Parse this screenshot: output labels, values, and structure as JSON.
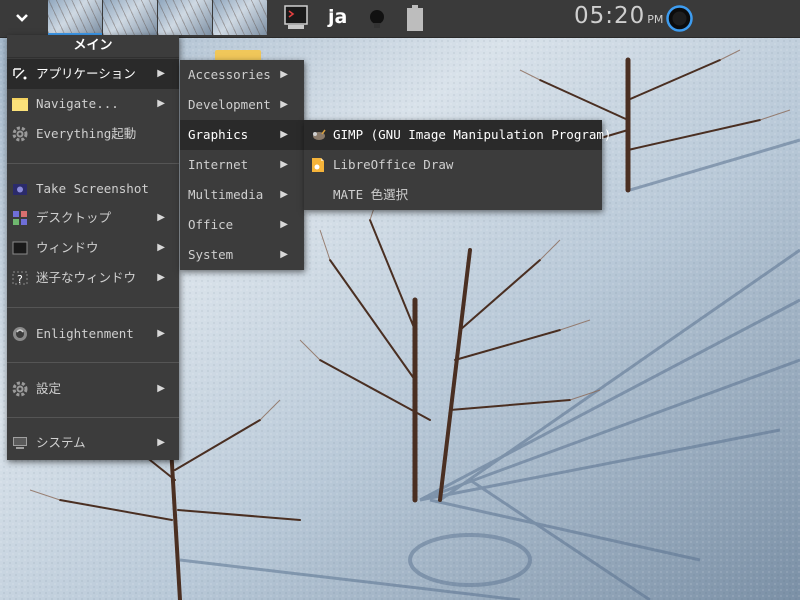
{
  "shelf": {
    "language": "ja",
    "clock_time": "05:20",
    "clock_ampm": "PM",
    "accent_color": "#3d9cf0",
    "icons": [
      "start-chevron-icon",
      "terminal-icon",
      "bulb-icon",
      "battery-icon",
      "power-icon"
    ]
  },
  "main_menu": {
    "title": "メイン",
    "items": [
      {
        "label": "アプリケーション",
        "icon": "applications-icon"
      },
      {
        "label": "Navigate...",
        "icon": "folder-icon"
      },
      {
        "label": "Everything起動",
        "icon": "gear-icon"
      },
      {
        "label": "Take Screenshot",
        "icon": "screenshot-icon"
      },
      {
        "label": "デスクトップ",
        "icon": "desktop-icon"
      },
      {
        "label": "ウィンドウ",
        "icon": "window-icon"
      },
      {
        "label": "迷子なウィンドウ",
        "icon": "lost-window-icon"
      },
      {
        "label": "Enlightenment",
        "icon": "enlightenment-icon"
      },
      {
        "label": "設定",
        "icon": "settings-icon"
      },
      {
        "label": "システム",
        "icon": "system-icon"
      }
    ]
  },
  "apps_menu": {
    "items": [
      "Accessories",
      "Development",
      "Graphics",
      "Internet",
      "Multimedia",
      "Office",
      "System"
    ]
  },
  "graphics_menu": {
    "items": [
      {
        "label": "GIMP (GNU Image Manipulation Program)",
        "icon": "gimp-icon"
      },
      {
        "label": "LibreOffice Draw",
        "icon": "libreoffice-draw-icon"
      },
      {
        "label": "MATE 色選択",
        "icon": ""
      }
    ]
  }
}
